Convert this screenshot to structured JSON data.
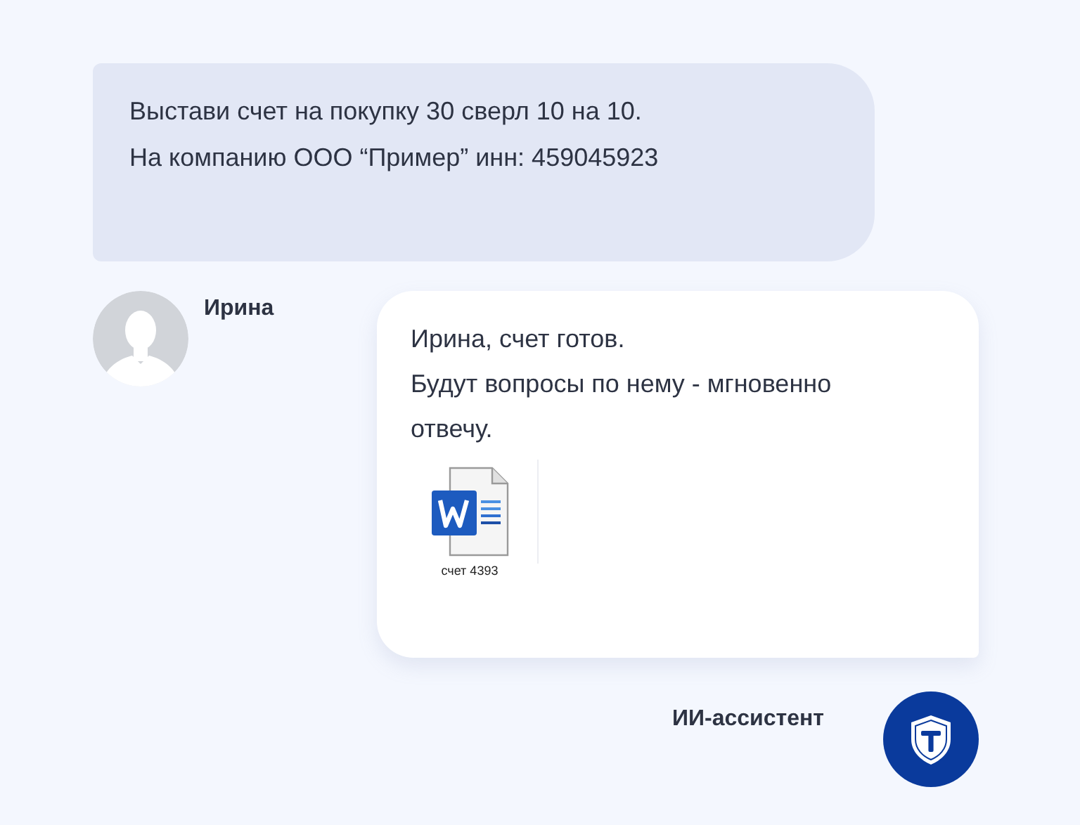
{
  "user_message": {
    "lines": [
      "Выстави счет на покупку 30 сверл 10 на 10.",
      "На компанию ООО “Пример” инн: 459045923"
    ]
  },
  "user": {
    "name": "Ирина"
  },
  "reply": {
    "lines": [
      "Ирина, счет готов.",
      "Будут вопросы по нему - мгновенно отвечу."
    ],
    "attachment": {
      "kind": "word",
      "name": "счет 4393"
    }
  },
  "assistant": {
    "name": "ИИ-ассистент"
  }
}
